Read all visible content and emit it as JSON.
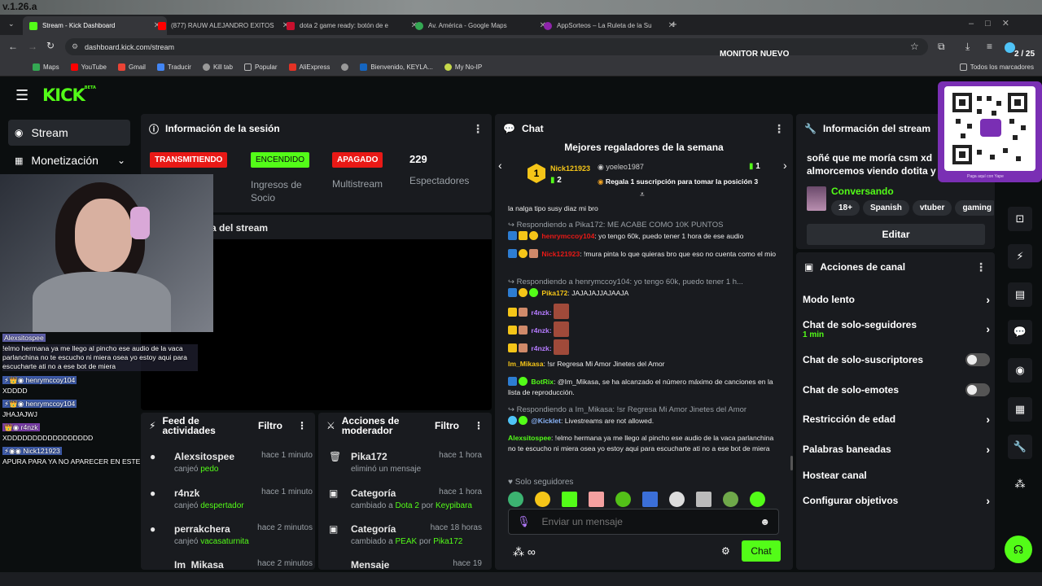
{
  "window": {
    "version": "v.1.26.a"
  },
  "tabs": [
    {
      "label": "Stream - Kick Dashboard",
      "color": "#53fc18",
      "active": true
    },
    {
      "label": "(877) RAUW ALEJANDRO EXITOS",
      "color": "#ff0000"
    },
    {
      "label": "dota 2 game ready: botón de e",
      "color": "#c8102e"
    },
    {
      "label": "Av. América - Google Maps",
      "color": "#34a853"
    },
    {
      "label": "AppSorteos – La Ruleta de la Su",
      "color": "#8e24aa"
    }
  ],
  "address": {
    "url": "dashboard.kick.com/stream",
    "monitor_label": "MONITOR NUEVO",
    "counter": "2 / 25"
  },
  "bookmarks": [
    "Maps",
    "YouTube",
    "Gmail",
    "Traducir",
    "Kill tab",
    "Popular",
    "AliExpress",
    "",
    "Bienvenido, KEYLA...",
    "My No-IP"
  ],
  "bookmarks_all": "Todos los marcadores",
  "nav": {
    "stream": "Stream",
    "monetizacion": "Monetización"
  },
  "session": {
    "title": "Información de la sesión",
    "live": "TRANSMITIENDO",
    "on": "ENCENDIDO",
    "ingresos": "Ingresos de Socio",
    "off": "APAGADO",
    "multistream": "Multistream",
    "viewers": "229",
    "viewers_label": "Espectadores",
    "preview_title": "a del stream"
  },
  "overlay_chat": [
    {
      "name": "Alexsitospee",
      "text": "!elmo hermana ya me llego al pincho ese audio de la vaca parlanchina no te escucho ni miera osea yo estoy aqui para escucharte ati no a ese bot de miera"
    },
    {
      "name": "henrymccoy104",
      "text": "XDDDD"
    },
    {
      "name": "henrymccoy104",
      "text": "JHAJAJWJ"
    },
    {
      "name": "r4nzk",
      "text": "XDDDDDDDDDDDDDDDDD"
    },
    {
      "name": "Nick121923",
      "text": "APURA PARA YA NO APARECER EN ESTE STREAM"
    }
  ],
  "feed": {
    "title": "Feed de actividades",
    "filter": "Filtro",
    "items": [
      {
        "user": "Alexsitospee",
        "time": "hace 1 minuto",
        "action": "canjeó",
        "item": "pedo"
      },
      {
        "user": "r4nzk",
        "time": "hace 1 minuto",
        "action": "canjeó",
        "item": "despertador"
      },
      {
        "user": "perrakchera",
        "time": "hace 2 minutos",
        "action": "canjeó",
        "item": "vacasaturnita"
      },
      {
        "user": "Im_Mikasa",
        "time": "hace 2 minutos"
      }
    ]
  },
  "mod": {
    "title": "Acciones de moderador",
    "filter": "Filtro",
    "items": [
      {
        "user": "Pika172",
        "time": "hace 1 hora",
        "desc": "eliminó un mensaje"
      },
      {
        "user": "Categoría",
        "time": "hace 1 hora",
        "desc": "cambiado a",
        "val": "Dota 2",
        "by": "por",
        "who": "Keypibara"
      },
      {
        "user": "Categoría",
        "time": "hace 18 horas",
        "desc": "cambiado a",
        "val": "PEAK",
        "by": "por",
        "who": "Pika172"
      },
      {
        "user": "Mensaje",
        "time": "hace 19"
      }
    ]
  },
  "chat": {
    "title": "Chat",
    "gifters_title": "Mejores regaladores de la semana",
    "top1": "Nick121923",
    "top1_count": "2",
    "top2": "yoeleo1987",
    "top2_count": "1",
    "cta": "Regala 1 suscripción para tomar la posición 3",
    "m0": "la nalga tipo susy diaz mi bro",
    "r1": "Respondiendo a Pika172: ME ACABE COMO 10K PUNTOS",
    "m1_user": "henrymccoy104",
    "m1_text": ": yo tengo 60k, puedo tener 1 hora de ese audio",
    "m2_user": "Nick121923",
    "m2_text": ": !mura pinta lo que quieras bro que eso no cuenta como el mio",
    "r3": "Respondiendo a henrymccoy104: yo tengo 60k, puedo tener 1 h...",
    "m3_user": "Pika172",
    "m3_text": ": JAJAJAJJAJAAJA",
    "m4_user": "r4nzk:",
    "m5_user": "r4nzk:",
    "m6_user": "r4nzk:",
    "m7_user": "Im_Mikasa",
    "m7_text": ": !sr Regresa Mi Amor Jinetes del Amor",
    "m8_user": "BotRix",
    "m8_text": ": @Im_Mikasa, se ha alcanzado el número máximo de canciones en la lista de reproducción.",
    "r9": "Respondiendo a Im_Mikasa: !sr Regresa Mi Amor Jinetes del Amor",
    "m9_user": "@Kicklet",
    "m9_text": ": Livestreams are not allowed.",
    "m10_user": "Alexsitospee",
    "m10_text": ": !elmo hermana ya me llego al pincho ese audio de la vaca parlanchina no te escucho ni miera osea yo estoy aqui para escucharte ati no a ese bot de miera",
    "followers_only": "Solo seguidores",
    "placeholder": "Enviar un mensaje",
    "send": "Chat"
  },
  "stream_info": {
    "title": "Información del stream",
    "stream_title": "soñé que me moría csm xd almorcemos viendo dotita y l",
    "category": "Conversando",
    "tags": [
      "18+",
      "Spanish",
      "vtuber",
      "gaming"
    ],
    "edit": "Editar"
  },
  "channel_actions": {
    "title": "Acciones de canal",
    "slow": "Modo lento",
    "followers": "Chat de solo-seguidores",
    "followers_sub": "1 min",
    "subs": "Chat de solo-suscriptores",
    "emotes": "Chat de solo-emotes",
    "age": "Restricción de edad",
    "banned": "Palabras baneadas",
    "host": "Hostear canal",
    "goals": "Configurar objetivos"
  },
  "qr": {
    "caption": "Paga aquí con Yape"
  },
  "colors": {
    "accent": "#53fc18",
    "live": "#e91916",
    "panel": "#191b1f"
  }
}
